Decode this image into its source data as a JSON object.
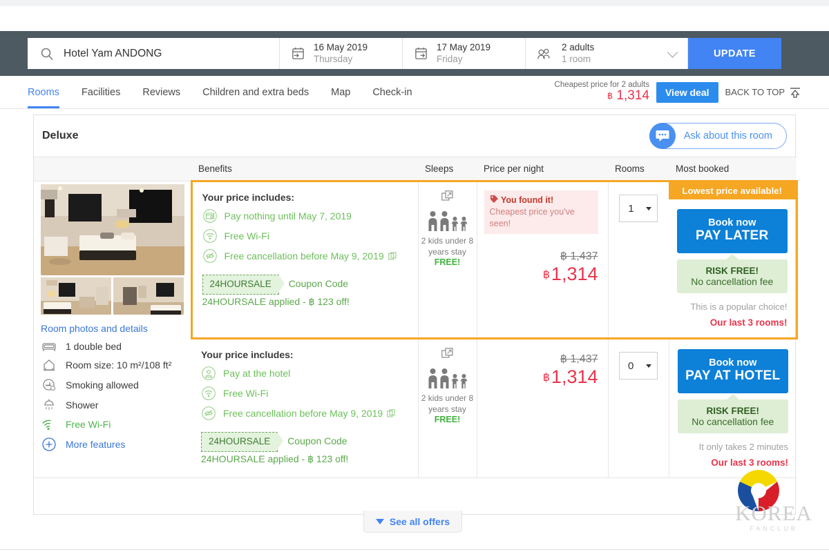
{
  "search": {
    "query": "Hotel Yam ANDONG",
    "checkin": {
      "date": "16 May 2019",
      "day": "Thursday"
    },
    "checkout": {
      "date": "17 May 2019",
      "day": "Friday"
    },
    "occupancy": {
      "adults": "2 adults",
      "rooms": "1 room"
    },
    "update_label": "UPDATE"
  },
  "nav": {
    "items": [
      {
        "label": "Rooms",
        "active": true
      },
      {
        "label": "Facilities",
        "active": false
      },
      {
        "label": "Reviews",
        "active": false
      },
      {
        "label": "Children and extra beds",
        "active": false
      },
      {
        "label": "Map",
        "active": false
      },
      {
        "label": "Check-in",
        "active": false
      }
    ],
    "cheapest_label": "Cheapest price for 2 adults",
    "cheapest_currency": "฿",
    "cheapest_price": "1,314",
    "view_deal": "View deal",
    "back_to_top": "BACK TO TOP"
  },
  "room": {
    "title": "Deluxe",
    "ask_label": "Ask about this room",
    "photos_link": "Room photos and details",
    "features": [
      {
        "icon": "bed-icon",
        "label": "1 double bed",
        "style": "plain"
      },
      {
        "icon": "room-size-icon",
        "label": "Room size: 10 m²/108 ft²",
        "style": "plain"
      },
      {
        "icon": "smoking-icon",
        "label": "Smoking allowed",
        "style": "plain"
      },
      {
        "icon": "shower-icon",
        "label": "Shower",
        "style": "plain"
      },
      {
        "icon": "wifi-icon",
        "label": "Free Wi-Fi",
        "style": "green"
      },
      {
        "icon": "plus-icon",
        "label": "More features",
        "style": "link"
      }
    ]
  },
  "table": {
    "headers": [
      "Benefits",
      "Sleeps",
      "Price per night",
      "Rooms",
      "Most booked"
    ]
  },
  "offers": [
    {
      "highlighted": true,
      "benefits": {
        "title": "Your price includes:",
        "items": [
          {
            "icon": "wallet-icon",
            "label": "Pay nothing until May 7, 2019",
            "external": false
          },
          {
            "icon": "wifi-icon",
            "label": "Free Wi-Fi",
            "external": false
          },
          {
            "icon": "cancel-icon",
            "label": "Free cancellation before May 9, 2019",
            "external": true
          }
        ],
        "coupon_tag": "24HOURSALE",
        "coupon_text": "Coupon Code 24HOURSALE applied - ฿ 123 off!"
      },
      "sleeps": {
        "note": "2 kids under 8 years stay",
        "free": "FREE!"
      },
      "price": {
        "banner_bold": "You found it!",
        "banner_rest": "Cheapest price you've seen!",
        "old": "฿ 1,437",
        "currency": "฿",
        "new": "1,314"
      },
      "rooms_value": "1",
      "most_booked": {
        "banner": "Lowest price available!",
        "book_line1": "Book now",
        "book_line2": "PAY LATER",
        "risk_line1": "RISK FREE!",
        "risk_line2": "No cancellation fee",
        "note": "This is a popular choice!",
        "urgency": "Our last 3 rooms!"
      }
    },
    {
      "highlighted": false,
      "benefits": {
        "title": "Your price includes:",
        "items": [
          {
            "icon": "pay-at-hotel-icon",
            "label": "Pay at the hotel",
            "external": false
          },
          {
            "icon": "wifi-icon",
            "label": "Free Wi-Fi",
            "external": false
          },
          {
            "icon": "cancel-icon",
            "label": "Free cancellation before May 9, 2019",
            "external": true
          }
        ],
        "coupon_tag": "24HOURSALE",
        "coupon_text": "Coupon Code 24HOURSALE applied - ฿ 123 off!"
      },
      "sleeps": {
        "note": "2 kids under 8 years stay",
        "free": "FREE!"
      },
      "price": {
        "banner_bold": "",
        "banner_rest": "",
        "old": "฿ 1,437",
        "currency": "฿",
        "new": "1,314"
      },
      "rooms_value": "0",
      "most_booked": {
        "banner": "",
        "book_line1": "Book now",
        "book_line2": "PAY AT HOTEL",
        "risk_line1": "RISK FREE!",
        "risk_line2": "No cancellation fee",
        "note": "It only takes 2 minutes",
        "urgency": "Our last 3 rooms!"
      }
    }
  ],
  "footer": {
    "see_all_offers": "See all offers"
  },
  "watermark": {
    "name": "KOREA",
    "sub": "FANCLUB"
  },
  "colors": {
    "accent_blue": "#4284f4",
    "book_blue": "#0d80d8",
    "price_red": "#e8344a",
    "highlight_orange": "#f5a623",
    "green": "#6bbf59",
    "header_bg": "#4d5a62"
  }
}
